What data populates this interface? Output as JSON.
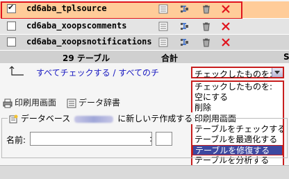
{
  "tables": [
    {
      "name": "cd6aba_tplsource",
      "checked": true
    },
    {
      "name": "cd6aba_xoopscomments",
      "checked": false
    },
    {
      "name": "cd6aba_xoopsnotifications",
      "checked": false
    }
  ],
  "totals": {
    "count_label": "29 テーブル",
    "sum_label": "合計",
    "edge_char": "S"
  },
  "check_all": "すべてチェックする / すべてのチ",
  "with_selected": {
    "value": "チェックしたものを:",
    "options": [
      "チェックしたものを:",
      "空にする",
      "削除",
      "印刷用画面",
      "テーブルをチェックする",
      "テーブルを最適化する",
      "テーブルを修復する",
      "テーブルを分析する"
    ],
    "highlighted_index": 6
  },
  "links": {
    "print": "印刷用画面",
    "dictionary": "データ辞書"
  },
  "create_table": {
    "legend_prefix": "データベース",
    "legend_suffix": "に新しいテ作成する",
    "name_label": "名前:",
    "fields_label": ":"
  },
  "colors": {
    "selected_row": "#ffcc99",
    "highlight": "#3d48a0",
    "outline": "#e0141e"
  }
}
